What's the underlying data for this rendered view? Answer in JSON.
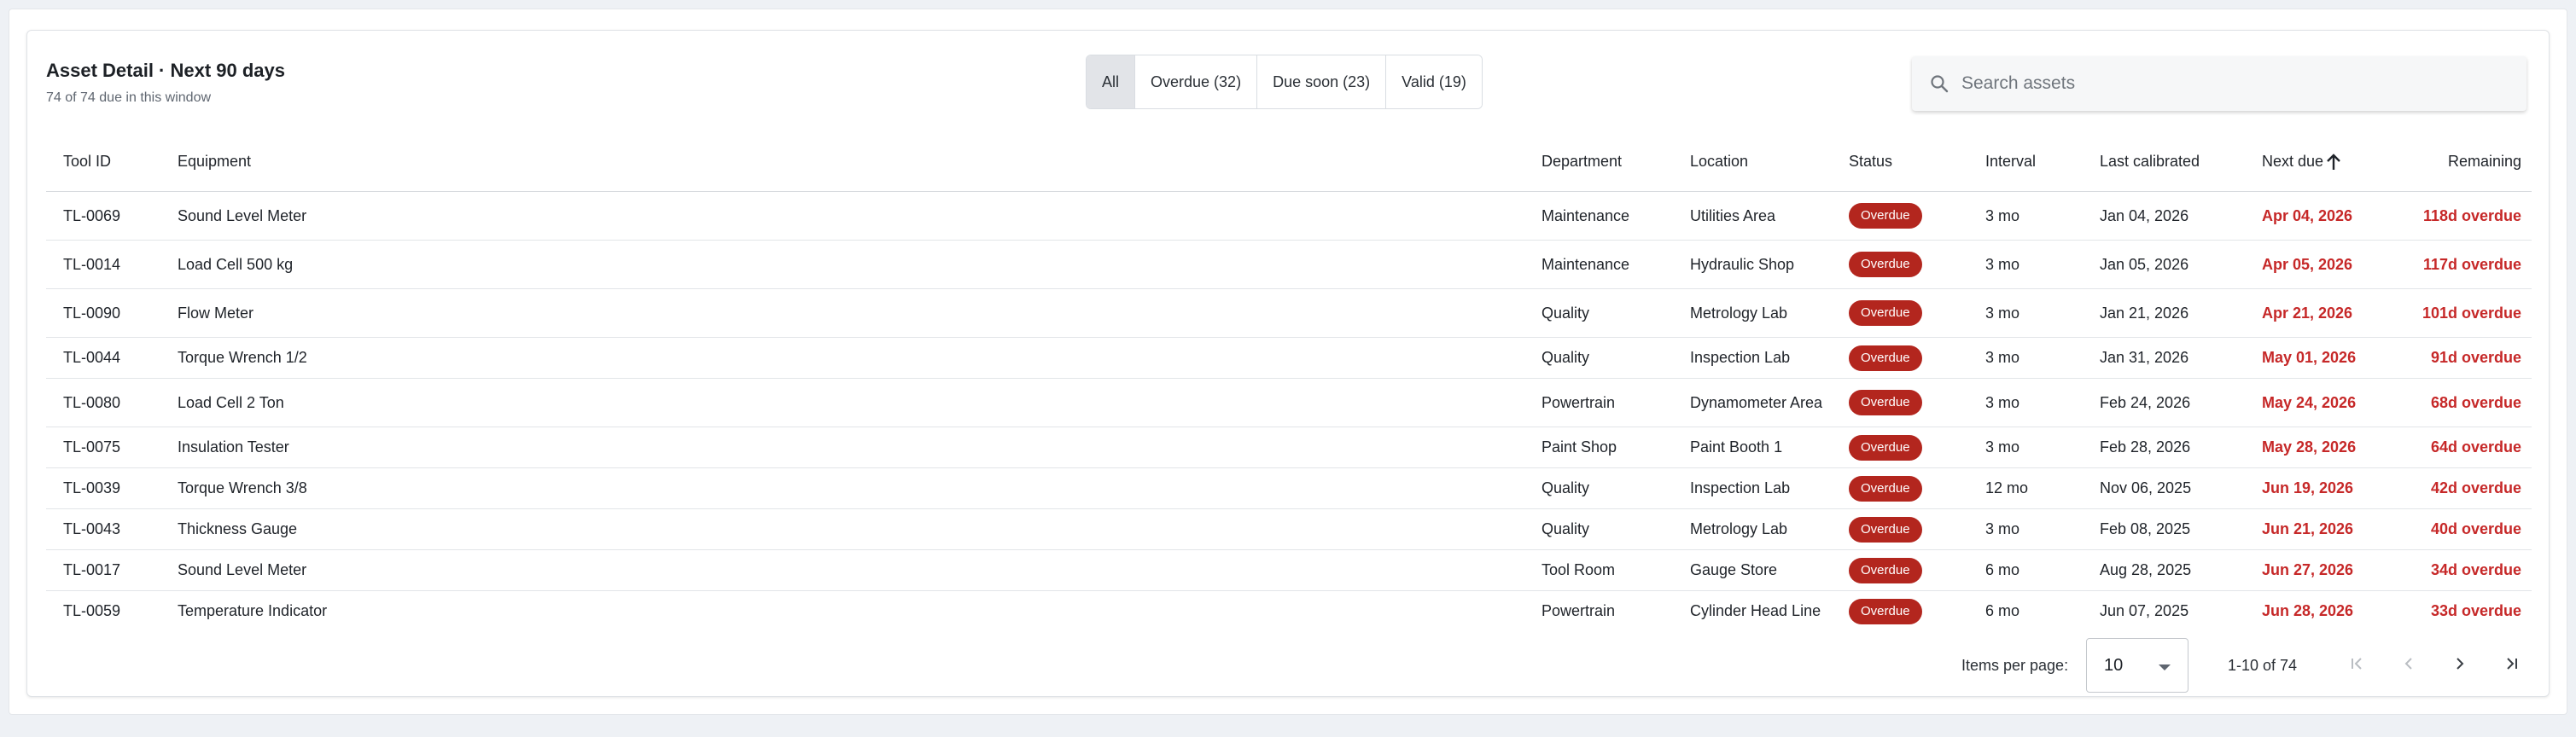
{
  "header": {
    "title": "Asset Detail · Next 90 days",
    "subtitle": "74 of 74 due in this window"
  },
  "filters": [
    {
      "label": "All",
      "active": true
    },
    {
      "label": "Overdue (32)",
      "active": false
    },
    {
      "label": "Due soon (23)",
      "active": false
    },
    {
      "label": "Valid (19)",
      "active": false
    }
  ],
  "search": {
    "placeholder": "Search assets",
    "icon": "search-icon"
  },
  "table": {
    "columns": {
      "tool_id": "Tool ID",
      "equipment": "Equipment",
      "department": "Department",
      "location": "Location",
      "status": "Status",
      "interval": "Interval",
      "last_calibrated": "Last calibrated",
      "next_due": "Next due",
      "remaining": "Remaining"
    },
    "sort": {
      "column": "next_due",
      "direction": "ascending",
      "icon": "arrow-up-icon"
    },
    "rows": [
      {
        "tool_id": "TL-0069",
        "equipment": "Sound Level Meter",
        "department": "Maintenance",
        "location": "Utilities Area",
        "status": "Overdue",
        "interval": "3 mo",
        "last_calibrated": "Jan 04, 2026",
        "next_due": "Apr 04, 2026",
        "remaining": "118d overdue"
      },
      {
        "tool_id": "TL-0014",
        "equipment": "Load Cell 500 kg",
        "department": "Maintenance",
        "location": "Hydraulic Shop",
        "status": "Overdue",
        "interval": "3 mo",
        "last_calibrated": "Jan 05, 2026",
        "next_due": "Apr 05, 2026",
        "remaining": "117d overdue"
      },
      {
        "tool_id": "TL-0090",
        "equipment": "Flow Meter",
        "department": "Quality",
        "location": "Metrology Lab",
        "status": "Overdue",
        "interval": "3 mo",
        "last_calibrated": "Jan 21, 2026",
        "next_due": "Apr 21, 2026",
        "remaining": "101d overdue"
      },
      {
        "tool_id": "TL-0044",
        "equipment": "Torque Wrench 1/2",
        "department": "Quality",
        "location": "Inspection Lab",
        "status": "Overdue",
        "interval": "3 mo",
        "last_calibrated": "Jan 31, 2026",
        "next_due": "May 01, 2026",
        "remaining": "91d overdue"
      },
      {
        "tool_id": "TL-0080",
        "equipment": "Load Cell 2 Ton",
        "department": "Powertrain",
        "location": "Dynamometer Area",
        "status": "Overdue",
        "interval": "3 mo",
        "last_calibrated": "Feb 24, 2026",
        "next_due": "May 24, 2026",
        "remaining": "68d overdue"
      },
      {
        "tool_id": "TL-0075",
        "equipment": "Insulation Tester",
        "department": "Paint Shop",
        "location": "Paint Booth 1",
        "status": "Overdue",
        "interval": "3 mo",
        "last_calibrated": "Feb 28, 2026",
        "next_due": "May 28, 2026",
        "remaining": "64d overdue"
      },
      {
        "tool_id": "TL-0039",
        "equipment": "Torque Wrench 3/8",
        "department": "Quality",
        "location": "Inspection Lab",
        "status": "Overdue",
        "interval": "12 mo",
        "last_calibrated": "Nov 06, 2025",
        "next_due": "Jun 19, 2026",
        "remaining": "42d overdue"
      },
      {
        "tool_id": "TL-0043",
        "equipment": "Thickness Gauge",
        "department": "Quality",
        "location": "Metrology Lab",
        "status": "Overdue",
        "interval": "3 mo",
        "last_calibrated": "Feb 08, 2025",
        "next_due": "Jun 21, 2026",
        "remaining": "40d overdue"
      },
      {
        "tool_id": "TL-0017",
        "equipment": "Sound Level Meter",
        "department": "Tool Room",
        "location": "Gauge Store",
        "status": "Overdue",
        "interval": "6 mo",
        "last_calibrated": "Aug 28, 2025",
        "next_due": "Jun 27, 2026",
        "remaining": "34d overdue"
      },
      {
        "tool_id": "TL-0059",
        "equipment": "Temperature Indicator",
        "department": "Powertrain",
        "location": "Cylinder Head Line",
        "status": "Overdue",
        "interval": "6 mo",
        "last_calibrated": "Jun 07, 2025",
        "next_due": "Jun 28, 2026",
        "remaining": "33d overdue"
      }
    ]
  },
  "paginator": {
    "items_per_page_label": "Items per page:",
    "items_per_page_value": "10",
    "range_label": "1-10 of 74",
    "first_icon": "first-page-icon",
    "prev_icon": "chevron-left-icon",
    "next_icon": "chevron-right-icon",
    "last_icon": "last-page-icon"
  },
  "colors": {
    "overdue_badge": "#b3261e",
    "overdue_text": "#c62828",
    "active_filter": "#e2e4e8"
  }
}
